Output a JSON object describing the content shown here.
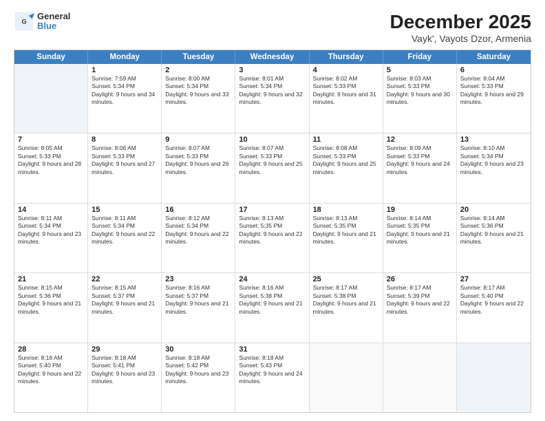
{
  "header": {
    "logo_general": "General",
    "logo_blue": "Blue",
    "title": "December 2025",
    "subtitle": "Vayk', Vayots Dzor, Armenia"
  },
  "days_of_week": [
    "Sunday",
    "Monday",
    "Tuesday",
    "Wednesday",
    "Thursday",
    "Friday",
    "Saturday"
  ],
  "rows": [
    [
      {
        "day": "",
        "sunrise": "",
        "sunset": "",
        "daylight": ""
      },
      {
        "day": "1",
        "sunrise": "Sunrise: 7:59 AM",
        "sunset": "Sunset: 5:34 PM",
        "daylight": "Daylight: 9 hours and 34 minutes."
      },
      {
        "day": "2",
        "sunrise": "Sunrise: 8:00 AM",
        "sunset": "Sunset: 5:34 PM",
        "daylight": "Daylight: 9 hours and 33 minutes."
      },
      {
        "day": "3",
        "sunrise": "Sunrise: 8:01 AM",
        "sunset": "Sunset: 5:34 PM",
        "daylight": "Daylight: 9 hours and 32 minutes."
      },
      {
        "day": "4",
        "sunrise": "Sunrise: 8:02 AM",
        "sunset": "Sunset: 5:33 PM",
        "daylight": "Daylight: 9 hours and 31 minutes."
      },
      {
        "day": "5",
        "sunrise": "Sunrise: 8:03 AM",
        "sunset": "Sunset: 5:33 PM",
        "daylight": "Daylight: 9 hours and 30 minutes."
      },
      {
        "day": "6",
        "sunrise": "Sunrise: 8:04 AM",
        "sunset": "Sunset: 5:33 PM",
        "daylight": "Daylight: 9 hours and 29 minutes."
      }
    ],
    [
      {
        "day": "7",
        "sunrise": "Sunrise: 8:05 AM",
        "sunset": "Sunset: 5:33 PM",
        "daylight": "Daylight: 9 hours and 28 minutes."
      },
      {
        "day": "8",
        "sunrise": "Sunrise: 8:06 AM",
        "sunset": "Sunset: 5:33 PM",
        "daylight": "Daylight: 9 hours and 27 minutes."
      },
      {
        "day": "9",
        "sunrise": "Sunrise: 8:07 AM",
        "sunset": "Sunset: 5:33 PM",
        "daylight": "Daylight: 9 hours and 26 minutes."
      },
      {
        "day": "10",
        "sunrise": "Sunrise: 8:07 AM",
        "sunset": "Sunset: 5:33 PM",
        "daylight": "Daylight: 9 hours and 25 minutes."
      },
      {
        "day": "11",
        "sunrise": "Sunrise: 8:08 AM",
        "sunset": "Sunset: 5:33 PM",
        "daylight": "Daylight: 9 hours and 25 minutes."
      },
      {
        "day": "12",
        "sunrise": "Sunrise: 8:09 AM",
        "sunset": "Sunset: 5:33 PM",
        "daylight": "Daylight: 9 hours and 24 minutes."
      },
      {
        "day": "13",
        "sunrise": "Sunrise: 8:10 AM",
        "sunset": "Sunset: 5:34 PM",
        "daylight": "Daylight: 9 hours and 23 minutes."
      }
    ],
    [
      {
        "day": "14",
        "sunrise": "Sunrise: 8:11 AM",
        "sunset": "Sunset: 5:34 PM",
        "daylight": "Daylight: 9 hours and 23 minutes."
      },
      {
        "day": "15",
        "sunrise": "Sunrise: 8:11 AM",
        "sunset": "Sunset: 5:34 PM",
        "daylight": "Daylight: 9 hours and 22 minutes."
      },
      {
        "day": "16",
        "sunrise": "Sunrise: 8:12 AM",
        "sunset": "Sunset: 5:34 PM",
        "daylight": "Daylight: 9 hours and 22 minutes."
      },
      {
        "day": "17",
        "sunrise": "Sunrise: 8:13 AM",
        "sunset": "Sunset: 5:35 PM",
        "daylight": "Daylight: 9 hours and 22 minutes."
      },
      {
        "day": "18",
        "sunrise": "Sunrise: 8:13 AM",
        "sunset": "Sunset: 5:35 PM",
        "daylight": "Daylight: 9 hours and 21 minutes."
      },
      {
        "day": "19",
        "sunrise": "Sunrise: 8:14 AM",
        "sunset": "Sunset: 5:35 PM",
        "daylight": "Daylight: 9 hours and 21 minutes."
      },
      {
        "day": "20",
        "sunrise": "Sunrise: 8:14 AM",
        "sunset": "Sunset: 5:36 PM",
        "daylight": "Daylight: 9 hours and 21 minutes."
      }
    ],
    [
      {
        "day": "21",
        "sunrise": "Sunrise: 8:15 AM",
        "sunset": "Sunset: 5:36 PM",
        "daylight": "Daylight: 9 hours and 21 minutes."
      },
      {
        "day": "22",
        "sunrise": "Sunrise: 8:15 AM",
        "sunset": "Sunset: 5:37 PM",
        "daylight": "Daylight: 9 hours and 21 minutes."
      },
      {
        "day": "23",
        "sunrise": "Sunrise: 8:16 AM",
        "sunset": "Sunset: 5:37 PM",
        "daylight": "Daylight: 9 hours and 21 minutes."
      },
      {
        "day": "24",
        "sunrise": "Sunrise: 8:16 AM",
        "sunset": "Sunset: 5:38 PM",
        "daylight": "Daylight: 9 hours and 21 minutes."
      },
      {
        "day": "25",
        "sunrise": "Sunrise: 8:17 AM",
        "sunset": "Sunset: 5:38 PM",
        "daylight": "Daylight: 9 hours and 21 minutes."
      },
      {
        "day": "26",
        "sunrise": "Sunrise: 8:17 AM",
        "sunset": "Sunset: 5:39 PM",
        "daylight": "Daylight: 9 hours and 22 minutes."
      },
      {
        "day": "27",
        "sunrise": "Sunrise: 8:17 AM",
        "sunset": "Sunset: 5:40 PM",
        "daylight": "Daylight: 9 hours and 22 minutes."
      }
    ],
    [
      {
        "day": "28",
        "sunrise": "Sunrise: 8:18 AM",
        "sunset": "Sunset: 5:40 PM",
        "daylight": "Daylight: 9 hours and 22 minutes."
      },
      {
        "day": "29",
        "sunrise": "Sunrise: 8:18 AM",
        "sunset": "Sunset: 5:41 PM",
        "daylight": "Daylight: 9 hours and 23 minutes."
      },
      {
        "day": "30",
        "sunrise": "Sunrise: 8:18 AM",
        "sunset": "Sunset: 5:42 PM",
        "daylight": "Daylight: 9 hours and 23 minutes."
      },
      {
        "day": "31",
        "sunrise": "Sunrise: 8:18 AM",
        "sunset": "Sunset: 5:43 PM",
        "daylight": "Daylight: 9 hours and 24 minutes."
      },
      {
        "day": "",
        "sunrise": "",
        "sunset": "",
        "daylight": ""
      },
      {
        "day": "",
        "sunrise": "",
        "sunset": "",
        "daylight": ""
      },
      {
        "day": "",
        "sunrise": "",
        "sunset": "",
        "daylight": ""
      }
    ]
  ]
}
